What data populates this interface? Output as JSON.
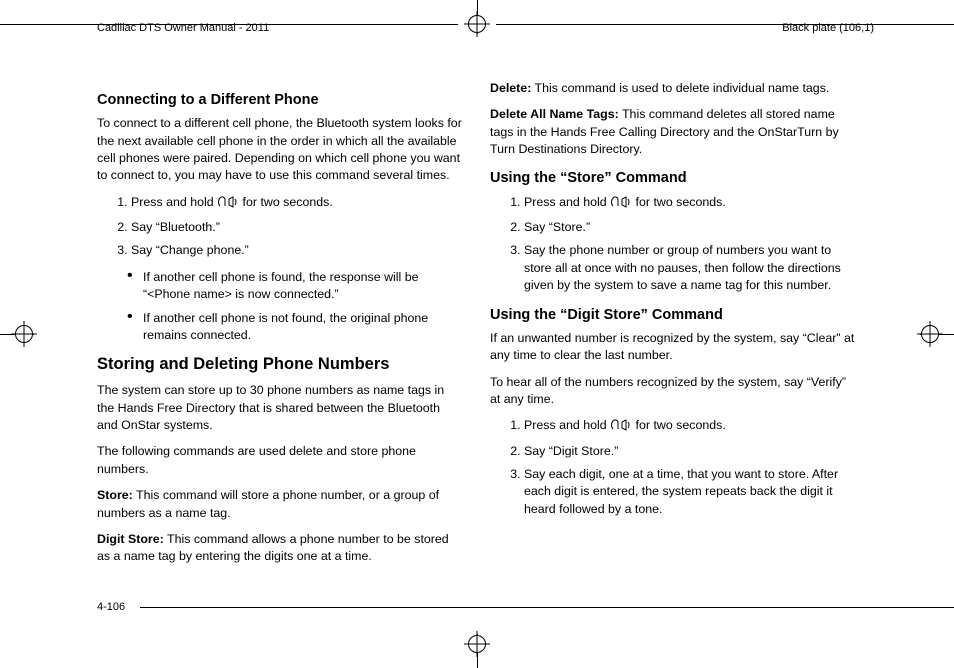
{
  "header": {
    "left": "Cadillac DTS Owner Manual - 2011",
    "right": "Black plate (106,1)"
  },
  "page_number": "4-106",
  "left_col": {
    "h3_connect": "Connecting to a Different Phone",
    "p_connect": "To connect to a different cell phone, the Bluetooth system looks for the next available cell phone in the order in which all the available cell phones were paired. Depending on which cell phone you want to connect to, you may have to use this command several times.",
    "ol_connect": [
      {
        "pre": "Press and hold ",
        "post": " for two seconds."
      },
      {
        "text": "Say “Bluetooth.”"
      },
      {
        "text": "Say “Change phone.”"
      }
    ],
    "ul_connect": [
      "If another cell phone is found, the response will be “<Phone name> is now connected.”",
      "If another cell phone is not found, the original phone remains connected."
    ],
    "h2_storedel": "Storing and Deleting Phone Numbers",
    "p_storedel_1": "The system can store up to 30 phone numbers as name tags in the Hands Free Directory that is shared between the Bluetooth and OnStar systems.",
    "p_storedel_2": "The following commands are used delete and store phone numbers.",
    "cmd_store_label": "Store:",
    "cmd_store_text": " This command will store a phone number, or a group of numbers as a name tag.",
    "cmd_digitstore_label": "Digit Store:",
    "cmd_digitstore_text": " This command allows a phone number to be stored as a name tag by entering the digits one at a time."
  },
  "right_col": {
    "cmd_delete_label": "Delete:",
    "cmd_delete_text": " This command is used to delete individual name tags.",
    "cmd_delall_label": "Delete All Name Tags:",
    "cmd_delall_text": " This command deletes all stored name tags in the Hands Free Calling Directory and the OnStarTurn by Turn Destinations Directory.",
    "h3_store": "Using the “Store” Command",
    "ol_store": [
      {
        "pre": "Press and hold ",
        "post": " for two seconds."
      },
      {
        "text": "Say “Store.”"
      },
      {
        "text": "Say the phone number or group of numbers you want to store all at once with no pauses, then follow the directions given by the system to save a name tag for this number."
      }
    ],
    "h3_digitstore": "Using the “Digit Store” Command",
    "p_digitstore_1": "If an unwanted number is recognized by the system, say “Clear” at any time to clear the last number.",
    "p_digitstore_2": "To hear all of the numbers recognized by the system, say “Verify” at any time.",
    "ol_digitstore": [
      {
        "pre": "Press and hold ",
        "post": " for two seconds."
      },
      {
        "text": "Say “Digit Store.”"
      },
      {
        "text": "Say each digit, one at a time, that you want to store. After each digit is entered, the system repeats back the digit it heard followed by a tone."
      }
    ]
  }
}
